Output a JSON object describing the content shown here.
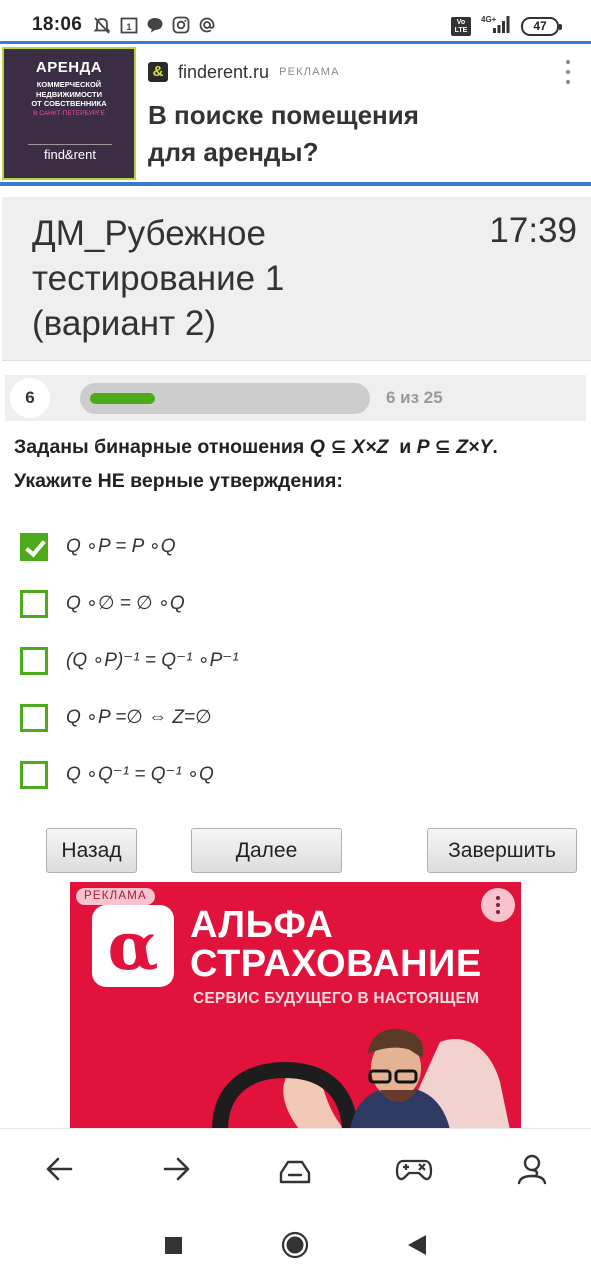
{
  "status_bar": {
    "time": "18:06",
    "battery": "47",
    "volte": "Vo LTE",
    "network": "4G+"
  },
  "top_ad": {
    "thumb_title": "АРЕНДА",
    "thumb_subtitle_1": "КОММЕРЧЕСКОЙ",
    "thumb_subtitle_2": "НЕДВИЖИМОСТИ",
    "thumb_subtitle_3": "ОТ СОБСТВЕННИКА",
    "thumb_city": "В САНКТ-ПЕТЕРБУРГЕ",
    "thumb_logo": "find&rent",
    "site": "finderent.ru",
    "label": "РЕКЛАМА",
    "title_line1": "В поиске помещения",
    "title_line2": "для аренды?"
  },
  "test": {
    "title_line1": "ДМ_Рубежное",
    "title_line2": "тестирование 1",
    "title_line3": "(вариант 2)",
    "timer": "17:39"
  },
  "progress": {
    "question_number": "6",
    "text": "6 из 25",
    "current": 6,
    "total": 25,
    "fraction": 0.24
  },
  "question": {
    "prefix": "Заданы бинарные отношения ",
    "rel1": "Q ⊆ X×Z",
    "middle": "  и ",
    "rel2": "P ⊆ Z×Y",
    "suffix": ".",
    "line2": "Укажите НЕ верные утверждения:"
  },
  "options": [
    {
      "label": "Q ∘P = P ∘Q",
      "checked": true
    },
    {
      "label": "Q ∘∅ = ∅ ∘Q",
      "checked": false
    },
    {
      "label": "(Q ∘P)⁻¹ = Q⁻¹ ∘P⁻¹",
      "checked": false
    },
    {
      "label": "Q ∘P =∅ ⇔ Z=∅",
      "checked": false
    },
    {
      "label": "Q ∘Q⁻¹ = Q⁻¹ ∘Q",
      "checked": false
    }
  ],
  "buttons": {
    "back": "Назад",
    "next": "Далее",
    "finish": "Завершить"
  },
  "bottom_ad": {
    "label": "РЕКЛАМА",
    "brand_line1": "АЛЬФА",
    "brand_line2": "СТРАХОВАНИЕ",
    "slogan": "СЕРВИС БУДУЩЕГО В НАСТОЯЩЕМ",
    "color": "#e1123b"
  },
  "browser_nav": {
    "icons": [
      "back-arrow-icon",
      "forward-arrow-icon",
      "tabs-icon",
      "games-icon",
      "profile-icon"
    ]
  },
  "android_nav": {
    "icons": [
      "recent-apps-icon",
      "home-icon",
      "back-icon"
    ]
  },
  "colors": {
    "accent_green": "#4caa1c",
    "ad_border_blue": "#3a7bd5"
  }
}
